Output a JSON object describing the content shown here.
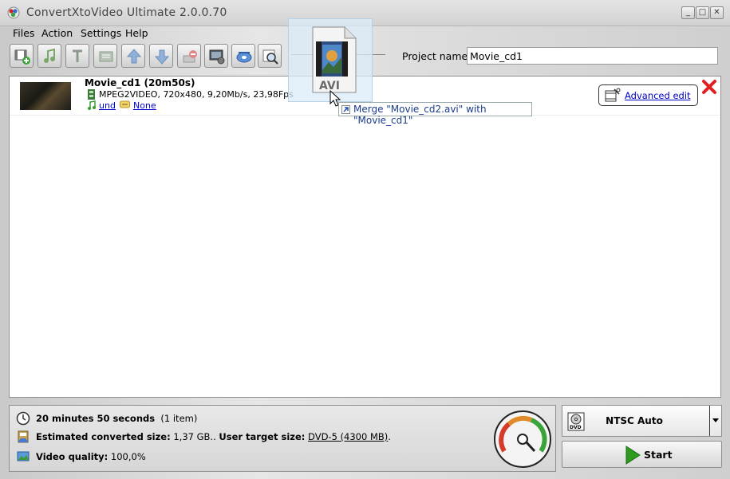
{
  "window": {
    "title": "ConvertXtoVideo Ultimate 2.0.0.70",
    "controls": [
      "minimize",
      "maximize",
      "close"
    ]
  },
  "menu": {
    "items": [
      "Files",
      "Action",
      "Settings",
      "Help"
    ]
  },
  "toolbar": {
    "buttons": [
      {
        "name": "add-video-button",
        "icon": "film-add-icon"
      },
      {
        "name": "add-audio-button",
        "icon": "music-add-icon"
      },
      {
        "name": "add-subtitle-button",
        "icon": "text-add-icon"
      },
      {
        "name": "add-chapters-button",
        "icon": "chapters-icon"
      },
      {
        "name": "move-up-button",
        "icon": "arrow-up-icon"
      },
      {
        "name": "move-down-button",
        "icon": "arrow-down-icon"
      },
      {
        "name": "remove-button",
        "icon": "remove-icon"
      },
      {
        "name": "settings-button",
        "icon": "monitor-settings-icon"
      },
      {
        "name": "burn-button",
        "icon": "disc-icon"
      },
      {
        "name": "preview-button",
        "icon": "magnifier-icon"
      }
    ],
    "project_name_label": "Project name:",
    "project_name_value": "Movie_cd1"
  },
  "list": {
    "items": [
      {
        "title": "Movie_cd1 (20m50s)",
        "specs": "MPEG2VIDEO, 720x480, 9,20Mb/s, 23,98Fps",
        "audio": "und",
        "subtitle": "None",
        "advanced_edit": "Advanced edit"
      }
    ]
  },
  "drag": {
    "ghost_label": "AVI",
    "tooltip": "Merge \"Movie_cd2.avi\" with \"Movie_cd1\""
  },
  "status": {
    "duration_bold": "20 minutes 50 seconds",
    "duration_count": "(1 item)",
    "est_size_label": "Estimated converted size:",
    "est_size_value": "1,37 GB..",
    "target_size_label": "User target size:",
    "target_size_value": "DVD-5 (4300 MB)",
    "target_size_suffix": ".",
    "quality_label": "Video quality:",
    "quality_value": "100,0%"
  },
  "output": {
    "format": "NTSC Auto",
    "format_icon": "dvd-icon",
    "start_label": "Start"
  },
  "colors": {
    "link": "#0000cc",
    "start_arrow": "#2e9a1e",
    "remove_x": "#e02020"
  }
}
